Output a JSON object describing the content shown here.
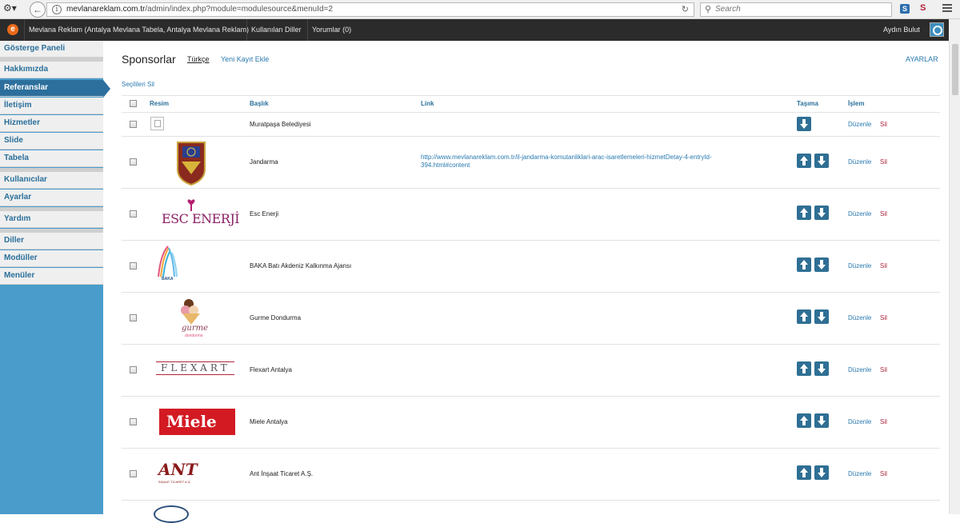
{
  "browser": {
    "url_host": "mevlanareklam.com.tr",
    "url_path": "/admin/index.php?module=modulesource&menuId=2",
    "search_placeholder": "Search",
    "ext1": "S",
    "ext2": "S"
  },
  "admin_bar": {
    "logo": "e",
    "site_name": "Mevlana Reklam (Antalya Mevlana Tabela, Antalya Mevlana Reklam)",
    "languages": "Kullanılan Diller",
    "comments": "Yorumlar (0)",
    "user": "Aydın Bulut"
  },
  "sidebar": {
    "items": [
      {
        "label": "Gösterge Paneli"
      },
      {
        "label": "Hakkımızda"
      },
      {
        "label": "Referanslar"
      },
      {
        "label": "İletişim"
      },
      {
        "label": "Hizmetler"
      },
      {
        "label": "Slide"
      },
      {
        "label": "Tabela"
      },
      {
        "label": "Kullanıcılar"
      },
      {
        "label": "Ayarlar"
      },
      {
        "label": "Yardım"
      },
      {
        "label": "Diller"
      },
      {
        "label": "Modüller"
      },
      {
        "label": "Menüler"
      }
    ],
    "active_index": 2
  },
  "main": {
    "title": "Sponsorlar",
    "language": "Türkçe",
    "new_record": "Yeni Kayıt Ekle",
    "settings": "AYARLAR",
    "delete_selected": "Seçilileri Sil",
    "columns": {
      "image": "Resim",
      "title": "Başlık",
      "link": "Link",
      "move": "Taşıma",
      "action": "İşlem"
    },
    "edit_label": "Düzenle",
    "delete_label": "Sil",
    "rows": [
      {
        "title": "Muratpaşa Belediyesi",
        "link": "",
        "logo": "placeholder-icon",
        "up": false,
        "down": true
      },
      {
        "title": "Jandarma",
        "link": "http://www.mevlanareklam.com.tr/il-jandarma-komutanliklari-arac-isaretlemeleri-hizmetDetay-4-entryId-394.html#content",
        "logo": "jandarma-emblem",
        "up": true,
        "down": true
      },
      {
        "title": "Esc Enerji",
        "link": "",
        "logo": "esc-enerji-logo",
        "logo_text": "ESC ENERJİ",
        "up": true,
        "down": true
      },
      {
        "title": "BAKA Batı Akdeniz Kalkınma Ajansı",
        "link": "",
        "logo": "baka-logo",
        "logo_text": "BAKA",
        "up": true,
        "down": true
      },
      {
        "title": "Gurme Dondurma",
        "link": "",
        "logo": "gurme-logo",
        "logo_text": "gurme",
        "logo_sub": "dondurma",
        "up": true,
        "down": true
      },
      {
        "title": "Flexart Antalya",
        "link": "",
        "logo": "flexart-logo",
        "logo_text": "FLEXART",
        "up": true,
        "down": true
      },
      {
        "title": "Miele Antalya",
        "link": "",
        "logo": "miele-logo",
        "logo_text": "Miele",
        "up": true,
        "down": true
      },
      {
        "title": "Ant İnşaat Ticaret A.Ş.",
        "link": "",
        "logo": "ant-logo",
        "logo_text": "ANT",
        "logo_sub": "İNŞAAT TİCARET A.Ş.",
        "up": true,
        "down": true
      }
    ]
  }
}
